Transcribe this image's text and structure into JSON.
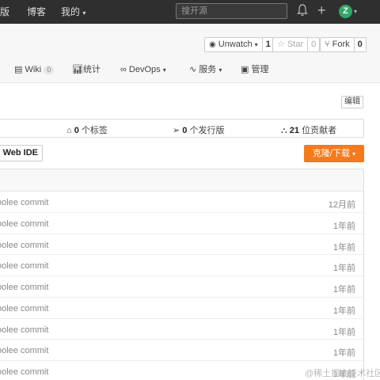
{
  "topbar": {
    "nav": [
      "版",
      "博客",
      "我的"
    ],
    "search_placeholder": "搜开源",
    "avatar_letter": "Z",
    "avatar_color": "#2fa86a"
  },
  "repo_actions": {
    "watch": {
      "label": "Unwatch",
      "count": "1"
    },
    "star": {
      "label": "Star",
      "count": "0"
    },
    "fork": {
      "label": "Fork",
      "count": "0"
    }
  },
  "tabs": [
    {
      "label": "Wiki",
      "badge": "0"
    },
    {
      "label": "统计"
    },
    {
      "label": "DevOps"
    },
    {
      "label": "服务"
    },
    {
      "label": "管理"
    }
  ],
  "edit_label": "编辑",
  "stats": {
    "tags": {
      "count": "0",
      "label": "个标签"
    },
    "releases": {
      "count": "0",
      "label": "个发行版"
    },
    "contributors": {
      "count": "21",
      "label": "位贡献者"
    }
  },
  "web_ide_label": "Web IDE",
  "clone_label": "克隆/下载",
  "accent_color": "#f57a1d",
  "commits": [
    {
      "message": "oolee commit",
      "time": "12月前"
    },
    {
      "message": "oolee commit",
      "time": "1年前"
    },
    {
      "message": "oolee commit",
      "time": "1年前"
    },
    {
      "message": "oolee commit",
      "time": "1年前"
    },
    {
      "message": "oolee commit",
      "time": "1年前"
    },
    {
      "message": "oolee commit",
      "time": "1年前"
    },
    {
      "message": "oolee commit",
      "time": "1年前"
    },
    {
      "message": "oolee commit",
      "time": "1年前"
    },
    {
      "message": "oolee commit",
      "time": "1年前"
    }
  ],
  "watermark": "@稀土掘金技术社区"
}
